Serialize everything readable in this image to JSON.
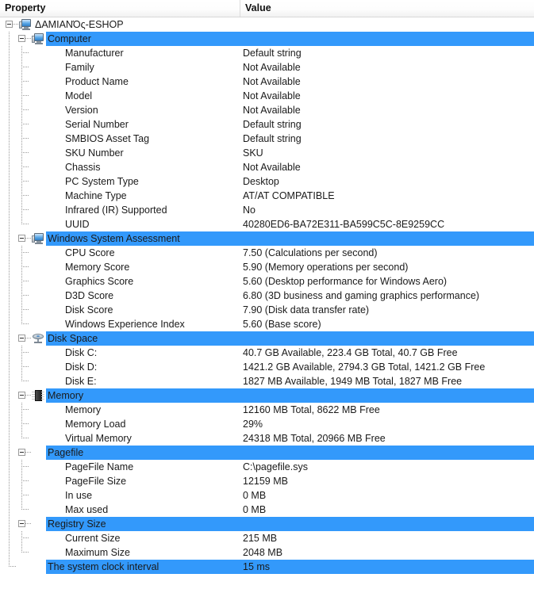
{
  "columns": {
    "property_header": "Property",
    "value_header": "Value"
  },
  "colors": {
    "highlight": "#3399fb",
    "highlight_text": "#ffffff",
    "text": "#1a1a1a",
    "background": "#ffffff"
  },
  "tree": {
    "root": {
      "label": "ΔAMIANΌς-ESHOP",
      "icon": "computer-monitor-icon",
      "expanded": true
    },
    "sections": [
      {
        "label": "Computer",
        "icon": "computer-monitor-icon",
        "highlighted": true,
        "expanded": true,
        "rows": [
          {
            "property": "Manufacturer",
            "value": "Default string"
          },
          {
            "property": "Family",
            "value": "Not Available"
          },
          {
            "property": "Product Name",
            "value": "Not Available"
          },
          {
            "property": "Model",
            "value": "Not Available"
          },
          {
            "property": "Version",
            "value": "Not Available"
          },
          {
            "property": "Serial Number",
            "value": "Default string"
          },
          {
            "property": "SMBIOS Asset Tag",
            "value": "Default string"
          },
          {
            "property": "SKU Number",
            "value": "SKU"
          },
          {
            "property": "Chassis",
            "value": "Not Available"
          },
          {
            "property": "PC System Type",
            "value": "Desktop"
          },
          {
            "property": "Machine Type",
            "value": "AT/AT COMPATIBLE"
          },
          {
            "property": "Infrared (IR) Supported",
            "value": "No"
          },
          {
            "property": "UUID",
            "value": "40280ED6-BA72E311-BA599C5C-8E9259CC"
          }
        ]
      },
      {
        "label": "Windows System Assessment",
        "icon": "computer-monitor-icon",
        "highlighted": true,
        "expanded": true,
        "rows": [
          {
            "property": "CPU Score",
            "value": "7.50 (Calculations per second)"
          },
          {
            "property": "Memory Score",
            "value": "5.90 (Memory operations per second)"
          },
          {
            "property": "Graphics Score",
            "value": "5.60 (Desktop performance for Windows Aero)"
          },
          {
            "property": "D3D Score",
            "value": "6.80 (3D business and gaming graphics performance)"
          },
          {
            "property": "Disk Score",
            "value": "7.90 (Disk data transfer rate)"
          },
          {
            "property": "Windows Experience Index",
            "value": "5.60 (Base score)"
          }
        ]
      },
      {
        "label": "Disk Space",
        "icon": "hard-disk-icon",
        "highlighted": true,
        "expanded": true,
        "rows": [
          {
            "property": "Disk C:",
            "value": "40.7 GB Available, 223.4 GB Total, 40.7 GB Free"
          },
          {
            "property": "Disk D:",
            "value": "1421.2 GB Available, 2794.3 GB Total, 1421.2 GB Free"
          },
          {
            "property": "Disk E:",
            "value": "1827 MB Available, 1949 MB Total, 1827 MB Free"
          }
        ]
      },
      {
        "label": "Memory",
        "icon": "memory-chip-icon",
        "highlighted": true,
        "expanded": true,
        "rows": [
          {
            "property": "Memory",
            "value": "12160 MB Total, 8622 MB Free"
          },
          {
            "property": "Memory Load",
            "value": "29%"
          },
          {
            "property": "Virtual Memory",
            "value": "24318 MB Total, 20966 MB Free"
          }
        ]
      },
      {
        "label": "Pagefile",
        "icon": "none",
        "highlighted": true,
        "expanded": true,
        "rows": [
          {
            "property": "PageFile Name",
            "value": "C:\\pagefile.sys"
          },
          {
            "property": "PageFile Size",
            "value": "12159 MB"
          },
          {
            "property": "In use",
            "value": "0 MB"
          },
          {
            "property": "Max used",
            "value": "0 MB"
          }
        ]
      },
      {
        "label": "Registry Size",
        "icon": "none",
        "highlighted": true,
        "expanded": true,
        "rows": [
          {
            "property": "Current Size",
            "value": "215 MB"
          },
          {
            "property": "Maximum Size",
            "value": "2048 MB"
          }
        ]
      }
    ],
    "trailing_row": {
      "property": "The system clock interval",
      "value": "15 ms",
      "highlighted": true
    }
  }
}
